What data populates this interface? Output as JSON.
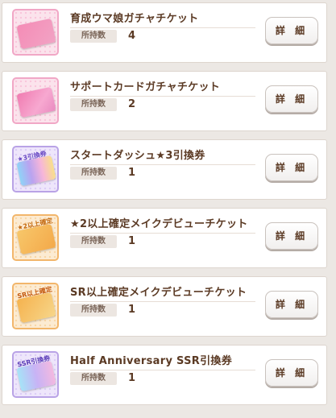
{
  "own_label": "所持数",
  "detail_label": "詳 細",
  "items": [
    {
      "title": "育成ウマ娘ガチャチケット",
      "count": "4",
      "icon": "pink-gacha-ticket-icon",
      "badge": ""
    },
    {
      "title": "サポートカードガチャチケット",
      "count": "2",
      "icon": "support-card-ticket-icon",
      "badge": ""
    },
    {
      "title": "スタートダッシュ★3引換券",
      "count": "1",
      "icon": "start-dash-exchange-ticket-icon",
      "badge": "★3引換券"
    },
    {
      "title": "★2以上確定メイクデビューチケット",
      "count": "1",
      "icon": "star2-debut-ticket-icon",
      "badge": "★2以上確定"
    },
    {
      "title": "SR以上確定メイクデビューチケット",
      "count": "1",
      "icon": "sr-debut-ticket-icon",
      "badge": "SR以上確定"
    },
    {
      "title": "Half Anniversary SSR引換券",
      "count": "1",
      "icon": "ssr-exchange-ticket-icon",
      "badge": "SSR引換券"
    }
  ],
  "colors": {
    "title_text": "#5b3a24",
    "card_bg": "#ffffff",
    "page_bg": "#ece8e4"
  }
}
